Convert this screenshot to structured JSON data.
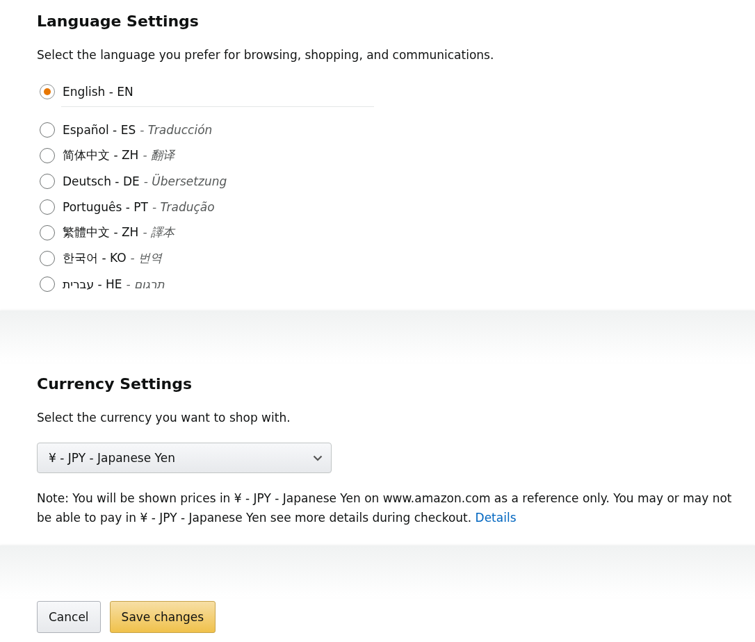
{
  "language": {
    "title": "Language Settings",
    "description": "Select the language you prefer for browsing, shopping, and communications.",
    "options": [
      {
        "label": "English - EN",
        "selected": true
      },
      {
        "label": "Español - ES",
        "translation": "- Traducción",
        "selected": false
      },
      {
        "label": "简体中文 - ZH",
        "translation": "- 翻译",
        "selected": false
      },
      {
        "label": "Deutsch - DE",
        "translation": "- Übersetzung",
        "selected": false
      },
      {
        "label": "Português - PT",
        "translation": "- Tradução",
        "selected": false
      },
      {
        "label": "繁體中文 - ZH",
        "translation": "- 譯本",
        "selected": false
      },
      {
        "label": "한국어 - KO",
        "translation": "- 번역",
        "selected": false
      },
      {
        "label": "עברית - HE",
        "translation": "- תרגום",
        "selected": false
      }
    ]
  },
  "currency": {
    "title": "Currency Settings",
    "description": "Select the currency you want to shop with.",
    "value": "¥ - JPY - Japanese Yen",
    "note": "Note: You will be shown prices in ¥ - JPY - Japanese Yen on www.amazon.com as a reference only. You may or may not be able to pay in ¥ - JPY - Japanese Yen see more details during checkout.",
    "link": "Details"
  },
  "buttons": [
    {
      "label": "Cancel",
      "kind": "secondary"
    },
    {
      "label": "Save changes",
      "kind": "primary"
    }
  ]
}
